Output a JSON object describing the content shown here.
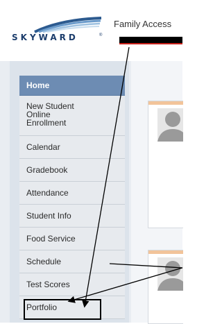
{
  "header": {
    "logo_text": "SKYWARD",
    "logo_mark": "®",
    "app_title": "Family Access"
  },
  "sidebar": {
    "items": [
      {
        "label": "Home"
      },
      {
        "label": "New Student Online Enrollment"
      },
      {
        "label": "Calendar"
      },
      {
        "label": "Gradebook"
      },
      {
        "label": "Attendance"
      },
      {
        "label": "Student Info"
      },
      {
        "label": "Food Service"
      },
      {
        "label": "Schedule"
      },
      {
        "label": "Test Scores"
      },
      {
        "label": "Portfolio"
      }
    ]
  },
  "icons": {
    "logo": "skyward-swoosh-icon",
    "avatar": "user-silhouette-icon"
  },
  "colors": {
    "nav_active": "#6d8cb3",
    "nav_item": "#e7eaee",
    "brand": "#1c3d6c",
    "card_accent": "#f2c49a",
    "annotation": "#000000"
  }
}
